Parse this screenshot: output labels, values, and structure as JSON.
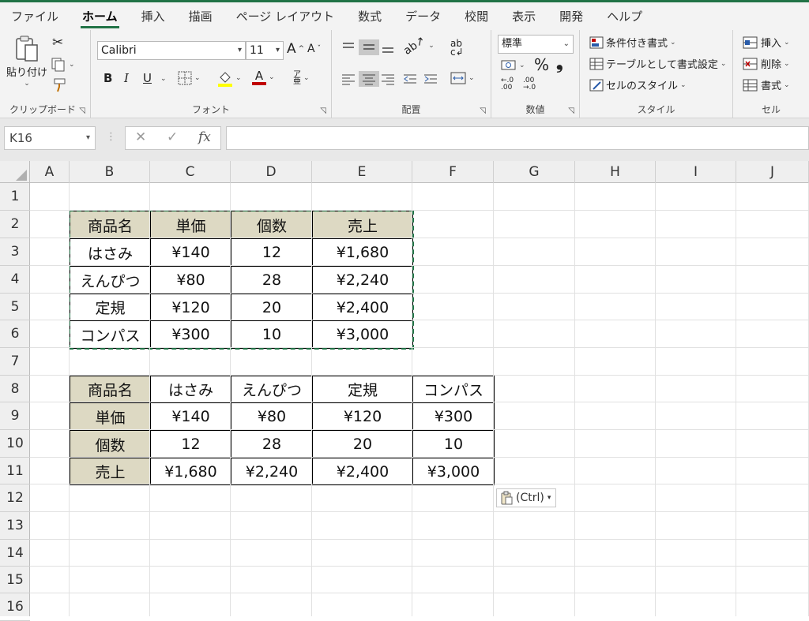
{
  "ribbon_tabs": [
    "ファイル",
    "ホーム",
    "挿入",
    "描画",
    "ページ レイアウト",
    "数式",
    "データ",
    "校閲",
    "表示",
    "開発",
    "ヘルプ"
  ],
  "active_tab": "ホーム",
  "ribbon": {
    "clipboard": {
      "paste_label": "貼り付け",
      "group_label": "クリップボード"
    },
    "font": {
      "font_name": "Calibri",
      "font_size": "11",
      "bold": "B",
      "italic": "I",
      "underline": "U",
      "group_label": "フォント"
    },
    "alignment": {
      "group_label": "配置"
    },
    "number": {
      "format": "標準",
      "percent": "%",
      "comma": "❟",
      "group_label": "数値"
    },
    "styles": {
      "conditional": "条件付き書式",
      "table": "テーブルとして書式設定",
      "cell_styles": "セルのスタイル",
      "group_label": "スタイル"
    },
    "cells": {
      "insert": "挿入",
      "delete": "削除",
      "format": "書式",
      "group_label": "セル"
    }
  },
  "formula_bar": {
    "name_box": "K16",
    "fx": "fx",
    "formula": ""
  },
  "sheet": {
    "columns": [
      "A",
      "B",
      "C",
      "D",
      "E",
      "F",
      "G",
      "H",
      "I",
      "J"
    ],
    "rows": [
      "1",
      "2",
      "3",
      "4",
      "5",
      "6",
      "7",
      "8",
      "9",
      "10",
      "11",
      "12",
      "13",
      "14",
      "15",
      "16"
    ],
    "table1": {
      "header": [
        "商品名",
        "単価",
        "個数",
        "売上"
      ],
      "rows": [
        [
          "はさみ",
          "¥140",
          "12",
          "¥1,680"
        ],
        [
          "えんぴつ",
          "¥80",
          "28",
          "¥2,240"
        ],
        [
          "定規",
          "¥120",
          "20",
          "¥2,400"
        ],
        [
          "コンパス",
          "¥300",
          "10",
          "¥3,000"
        ]
      ]
    },
    "table2": {
      "rows": [
        [
          "商品名",
          "はさみ",
          "えんぴつ",
          "定規",
          "コンパス"
        ],
        [
          "単価",
          "¥140",
          "¥80",
          "¥120",
          "¥300"
        ],
        [
          "個数",
          "12",
          "28",
          "20",
          "10"
        ],
        [
          "売上",
          "¥1,680",
          "¥2,240",
          "¥2,400",
          "¥3,000"
        ]
      ]
    },
    "paste_options": "(Ctrl)"
  },
  "colors": {
    "accent": "#217346",
    "header_fill": "#ddd9c3"
  }
}
